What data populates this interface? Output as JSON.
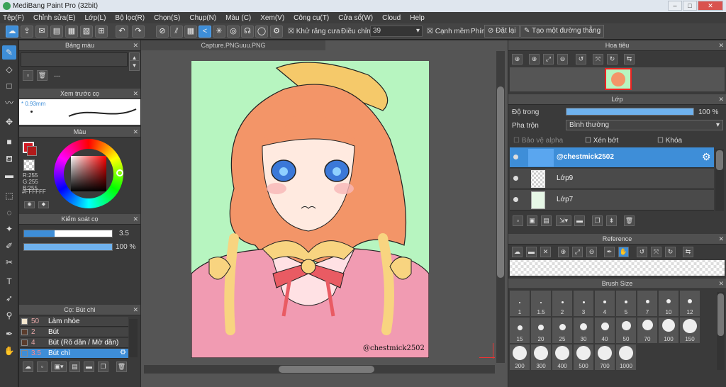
{
  "app": {
    "title": "MediBang Paint Pro (32bit)"
  },
  "menu": [
    "Tệp(F)",
    "Chỉnh sửa(E)",
    "Lớp(L)",
    "Bộ lọc(R)",
    "Chọn(S)",
    "Chụp(N)",
    "Màu (C)",
    "Xem(V)",
    "Công cụ(T)",
    "Cửa sổ(W)",
    "Cloud",
    "Help"
  ],
  "toolbar": {
    "antialias_label": "Khử răng cưa",
    "adjust_label": "Điều chỉnh",
    "adjust_value": "39",
    "edge_label": "Cạnh mềm",
    "key_label": "Phím",
    "reset_label": "Đặt lại",
    "create_line_label": "Tạo một đường thẳng"
  },
  "panels": {
    "color_table": {
      "title": "Bảng màu",
      "value": "---"
    },
    "brush_preview": {
      "title": "Xem trước cọ",
      "size": "0.93mm"
    },
    "color": {
      "title": "Màu",
      "r": "R:255",
      "g": "G:255",
      "b": "B:255",
      "hex": "#FFFFFF",
      "main_color": "#d21a24"
    },
    "brush_control": {
      "title": "Kiểm soát cọ",
      "size": "3.5",
      "opacity": "100 %",
      "opacity_pct": 100,
      "size_fill": 0.35
    },
    "brush": {
      "title": "Cọ: Bút chì",
      "items": [
        {
          "size": "50",
          "name": "Làm nhòe",
          "swatch": "#f4e7cf"
        },
        {
          "size": "2",
          "name": "Bút",
          "swatch": "#5a3c2c"
        },
        {
          "size": "4",
          "name": "Bút (Rõ dần / Mờ dần)",
          "swatch": "#5a3c2c"
        },
        {
          "size": "3.5",
          "name": "Bút chì",
          "swatch": "#3e8ed8",
          "selected": true
        }
      ]
    },
    "navigator": {
      "title": "Hoa tiêu"
    },
    "layer": {
      "title": "Lớp",
      "opacity_label": "Độ trong",
      "opacity": "100 %",
      "opacity_pct": 100,
      "blend_label": "Pha trộn",
      "blend_value": "Bình thường",
      "protect_alpha": "Bảo vệ alpha",
      "clipping": "Xén bớt",
      "lock": "Khóa",
      "layers": [
        {
          "name": "@chestmick2502",
          "selected": true
        },
        {
          "name": "Lớp9"
        },
        {
          "name": "Lớp7"
        }
      ]
    },
    "reference": {
      "title": "Reference"
    },
    "brush_size": {
      "title": "Brush Size",
      "sizes": [
        "1",
        "1.5",
        "2",
        "3",
        "4",
        "5",
        "7",
        "10",
        "12",
        "15",
        "20",
        "25",
        "30",
        "40",
        "50",
        "70",
        "100",
        "150",
        "200",
        "300",
        "400",
        "500",
        "700",
        "1000"
      ]
    }
  },
  "document": {
    "tab": "Capture.PNGuuu.PNG",
    "signature": "@chestmick2502"
  },
  "colors": {
    "accent": "#3e8ed8",
    "canvas_bg": "#b7f5c0"
  }
}
